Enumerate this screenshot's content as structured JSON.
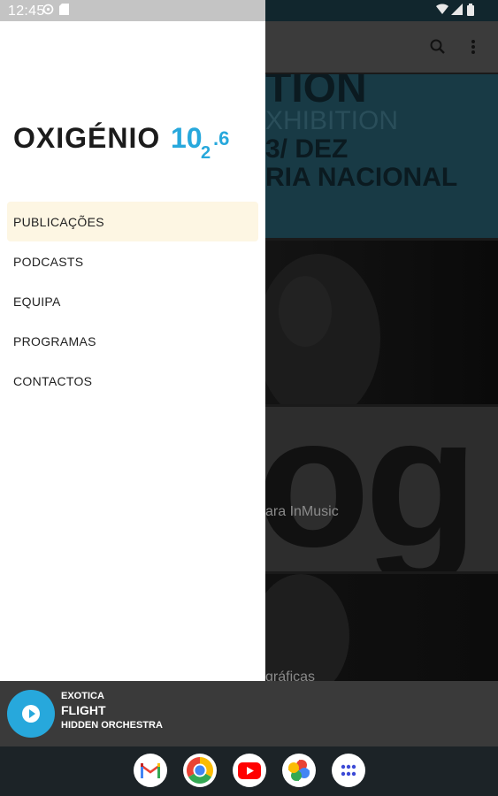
{
  "status_bar": {
    "time": "12:45"
  },
  "drawer": {
    "logo_text": "OXIGÉNIO",
    "logo_number": "102.6",
    "items": [
      {
        "label": "PUBLICAÇÕES",
        "active": true
      },
      {
        "label": "PODCASTS",
        "active": false
      },
      {
        "label": "EQUIPA",
        "active": false
      },
      {
        "label": "PROGRAMAS",
        "active": false
      },
      {
        "label": "CONTACTOS",
        "active": false
      }
    ]
  },
  "background_feed": {
    "card1": {
      "line1": "TION",
      "line2": "XHIBITION",
      "line3": "3/ DEZ",
      "line4": "RIA NACIONAL"
    },
    "card3": {
      "caption": "ara InMusic",
      "graphic_text": "og"
    },
    "card4": {
      "caption": "gráficas"
    }
  },
  "player": {
    "program": "EXOTICA",
    "title": "FLIGHT",
    "artist": "HIDDEN ORCHESTRA",
    "accent": "#27a8dc"
  },
  "taskbar": {
    "apps": [
      "gmail-icon",
      "chrome-icon",
      "youtube-icon",
      "photos-icon",
      "app-drawer-icon"
    ]
  }
}
